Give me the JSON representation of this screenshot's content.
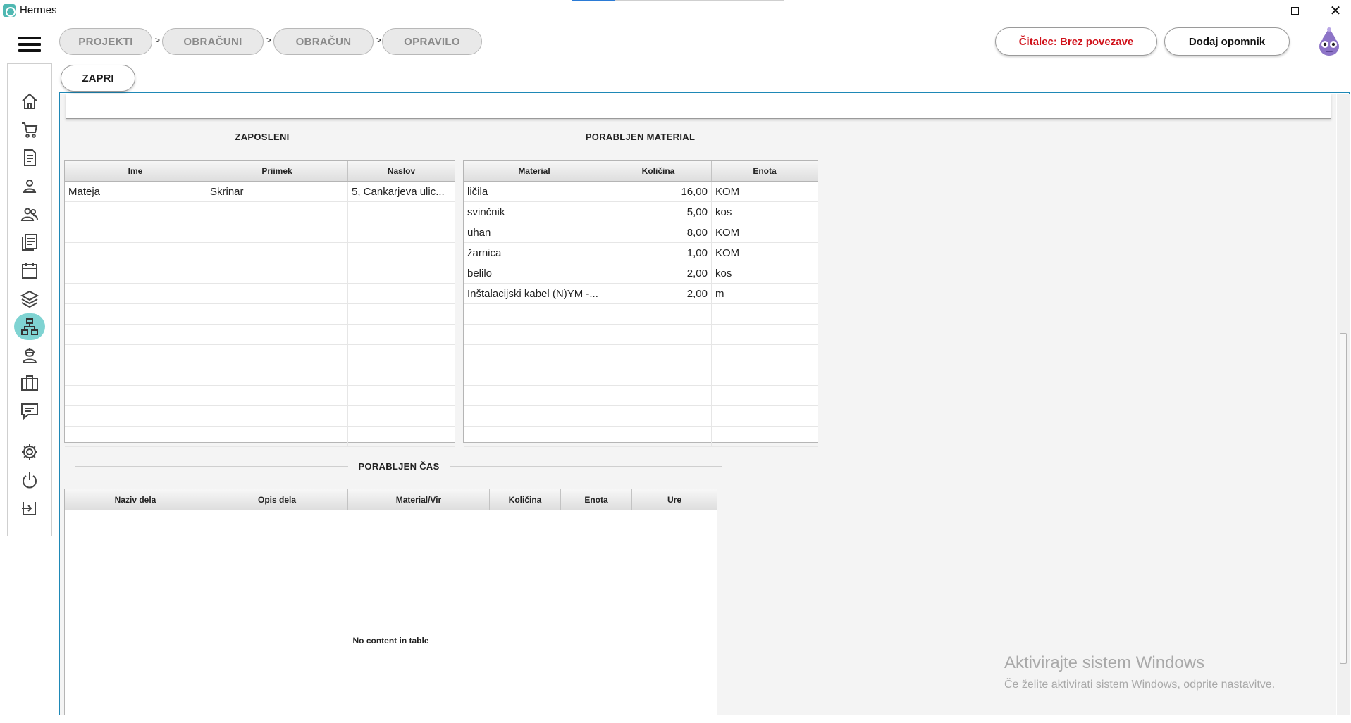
{
  "window": {
    "title": "Hermes"
  },
  "breadcrumb": {
    "items": [
      {
        "label": "PROJEKTI"
      },
      {
        "label": "OBRAČUNI"
      },
      {
        "label": "OBRAČUN"
      },
      {
        "label": "OPRAVILO"
      }
    ],
    "separator": ">"
  },
  "header": {
    "reader_status": "Čitalec: Brez povezave",
    "add_reminder": "Dodaj opomnik"
  },
  "panel": {
    "close_label": "ZAPRI"
  },
  "sidebar": {
    "items": [
      {
        "icon": "home-icon"
      },
      {
        "icon": "cart-icon"
      },
      {
        "icon": "document-icon"
      },
      {
        "icon": "person-icon"
      },
      {
        "icon": "people-icon"
      },
      {
        "icon": "list-document-icon"
      },
      {
        "icon": "calendar-icon"
      },
      {
        "icon": "layers-icon"
      },
      {
        "icon": "hierarchy-icon",
        "active": true
      },
      {
        "icon": "worker-icon"
      },
      {
        "icon": "briefcase-icon"
      },
      {
        "icon": "chat-icon"
      },
      {
        "icon": "gear-icon"
      },
      {
        "icon": "power-icon"
      },
      {
        "icon": "logout-icon"
      }
    ],
    "active_color": "#7fd3d2"
  },
  "employees": {
    "title": "ZAPOSLENI",
    "columns": [
      "Ime",
      "Priimek",
      "Naslov"
    ],
    "rows": [
      [
        "Mateja",
        "Skrinar",
        "5, Cankarjeva ulic..."
      ]
    ]
  },
  "material": {
    "title": "PORABLJEN MATERIAL",
    "columns": [
      "Material",
      "Količina",
      "Enota"
    ],
    "rows": [
      [
        "ličila",
        "16,00",
        "KOM"
      ],
      [
        "svinčnik",
        "5,00",
        "kos"
      ],
      [
        "uhan",
        "8,00",
        "KOM"
      ],
      [
        "žarnica",
        "1,00",
        "KOM"
      ],
      [
        "belilo",
        "2,00",
        "kos"
      ],
      [
        "Inštalacijski kabel (N)YM -...",
        "2,00",
        "m"
      ]
    ]
  },
  "time_spent": {
    "title": "PORABLJEN ČAS",
    "columns": [
      "Naziv dela",
      "Opis dela",
      "Material/Vir",
      "Količina",
      "Enota",
      "Ure"
    ],
    "empty_message": "No content in table"
  },
  "watermark": {
    "title": "Aktivirajte sistem Windows",
    "subtitle": "Če želite aktivirati sistem Windows, odprite nastavitve."
  },
  "colors": {
    "accent": "#1e88b6",
    "reader_status": "#d0121b",
    "app_icon": "#4fb8b2"
  }
}
